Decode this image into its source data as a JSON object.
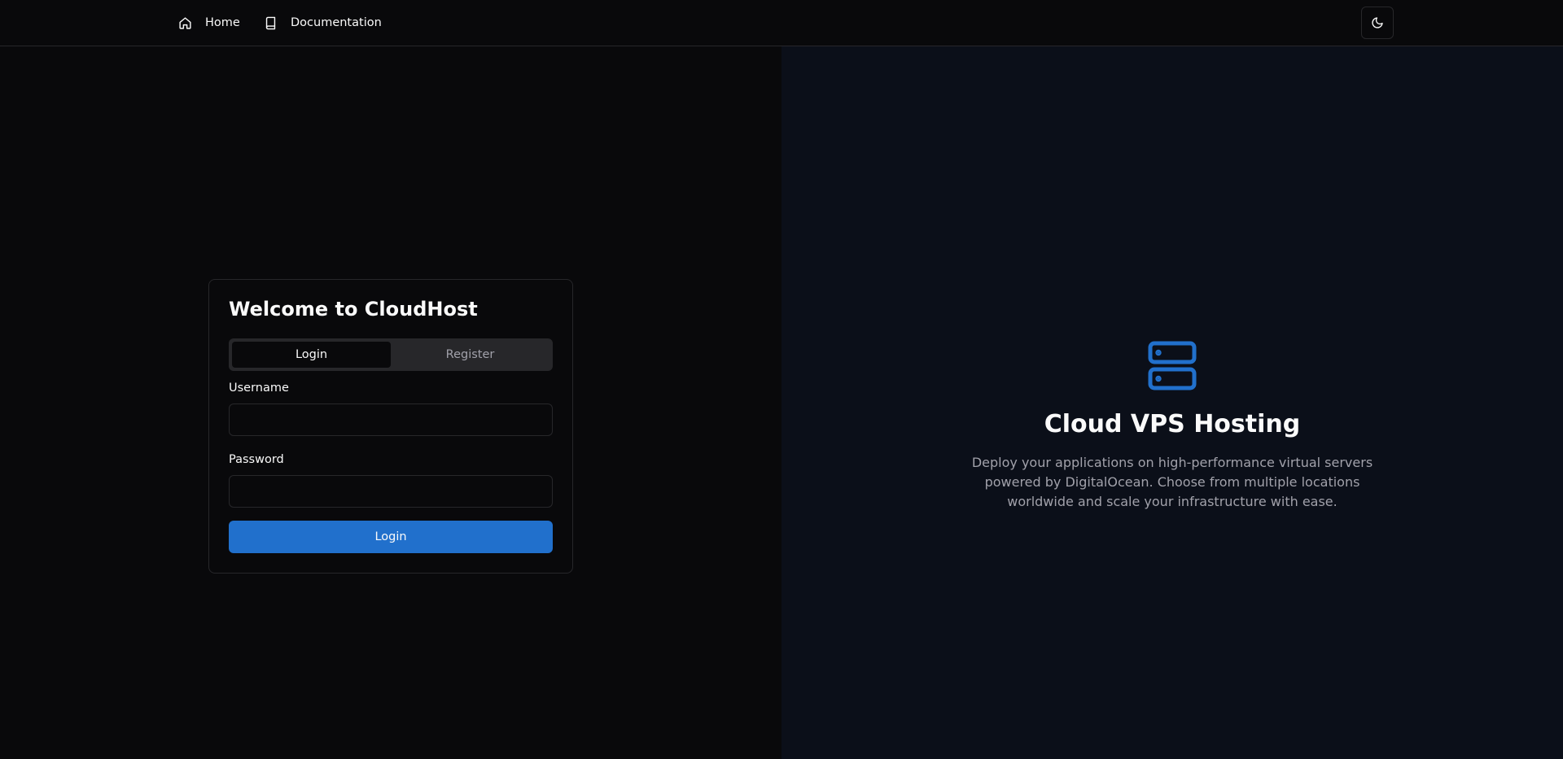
{
  "nav": {
    "home_label": "Home",
    "docs_label": "Documentation",
    "home_icon": "home-icon",
    "docs_icon": "book-icon",
    "theme_icon": "moon-icon"
  },
  "auth": {
    "title": "Welcome to CloudHost",
    "tabs": [
      {
        "label": "Login",
        "active": true
      },
      {
        "label": "Register",
        "active": false
      }
    ],
    "username_label": "Username",
    "username_value": "",
    "password_label": "Password",
    "password_value": "",
    "submit_label": "Login"
  },
  "hero": {
    "icon": "server-icon",
    "title": "Cloud VPS Hosting",
    "description": "Deploy your applications on high-performance virtual servers powered by DigitalOcean. Choose from multiple locations worldwide and scale your infrastructure with ease."
  },
  "colors": {
    "accent": "#2170cc",
    "background": "#09090b",
    "hero_background": "#0b0f19",
    "muted_text": "#a1a1aa",
    "border": "#27272a"
  }
}
